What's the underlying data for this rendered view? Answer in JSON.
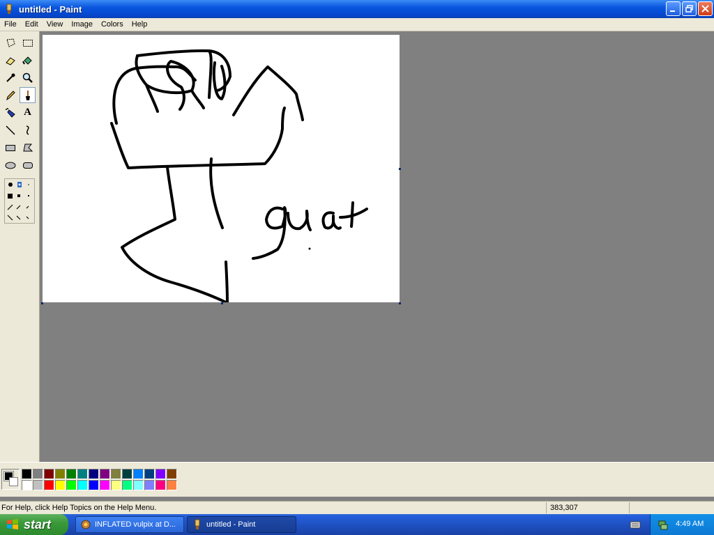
{
  "window": {
    "title": "untitled - Paint"
  },
  "menu": [
    "File",
    "Edit",
    "View",
    "Image",
    "Colors",
    "Help"
  ],
  "tools": [
    {
      "name": "free-form-select-tool",
      "icon": "free-select-icon"
    },
    {
      "name": "select-tool",
      "icon": "rect-select-icon"
    },
    {
      "name": "eraser-tool",
      "icon": "eraser-icon"
    },
    {
      "name": "fill-tool",
      "icon": "fill-bucket-icon"
    },
    {
      "name": "pick-color-tool",
      "icon": "eyedropper-icon"
    },
    {
      "name": "magnifier-tool",
      "icon": "magnifier-icon"
    },
    {
      "name": "pencil-tool",
      "icon": "pencil-icon"
    },
    {
      "name": "brush-tool",
      "icon": "brush-icon",
      "active": true
    },
    {
      "name": "airbrush-tool",
      "icon": "airbrush-icon"
    },
    {
      "name": "text-tool",
      "icon": "text-icon",
      "label": "A"
    },
    {
      "name": "line-tool",
      "icon": "line-icon"
    },
    {
      "name": "curve-tool",
      "icon": "curve-icon"
    },
    {
      "name": "rectangle-tool",
      "icon": "rectangle-icon"
    },
    {
      "name": "polygon-tool",
      "icon": "polygon-icon"
    },
    {
      "name": "ellipse-tool",
      "icon": "ellipse-icon"
    },
    {
      "name": "rounded-rectangle-tool",
      "icon": "rounded-rect-icon"
    }
  ],
  "colors": {
    "foreground": "#000000",
    "background": "#ffffff",
    "palette_top": [
      "#000000",
      "#808080",
      "#800000",
      "#808000",
      "#008000",
      "#008080",
      "#000080",
      "#800080",
      "#808040",
      "#004040",
      "#0080ff",
      "#004080",
      "#8000ff",
      "#804000"
    ],
    "palette_bottom": [
      "#ffffff",
      "#c0c0c0",
      "#ff0000",
      "#ffff00",
      "#00ff00",
      "#00ffff",
      "#0000ff",
      "#ff00ff",
      "#ffff80",
      "#00ff80",
      "#80ffff",
      "#8080ff",
      "#ff0080",
      "#ff8040"
    ]
  },
  "status": {
    "help": "For Help, click Help Topics on the Help Menu.",
    "coords": "383,307"
  },
  "taskbar": {
    "start": "start",
    "tasks": [
      {
        "label": "INFLATED vulpix at D...",
        "active": false
      },
      {
        "label": "untitled - Paint",
        "active": true
      }
    ],
    "clock": "4:49 AM"
  }
}
